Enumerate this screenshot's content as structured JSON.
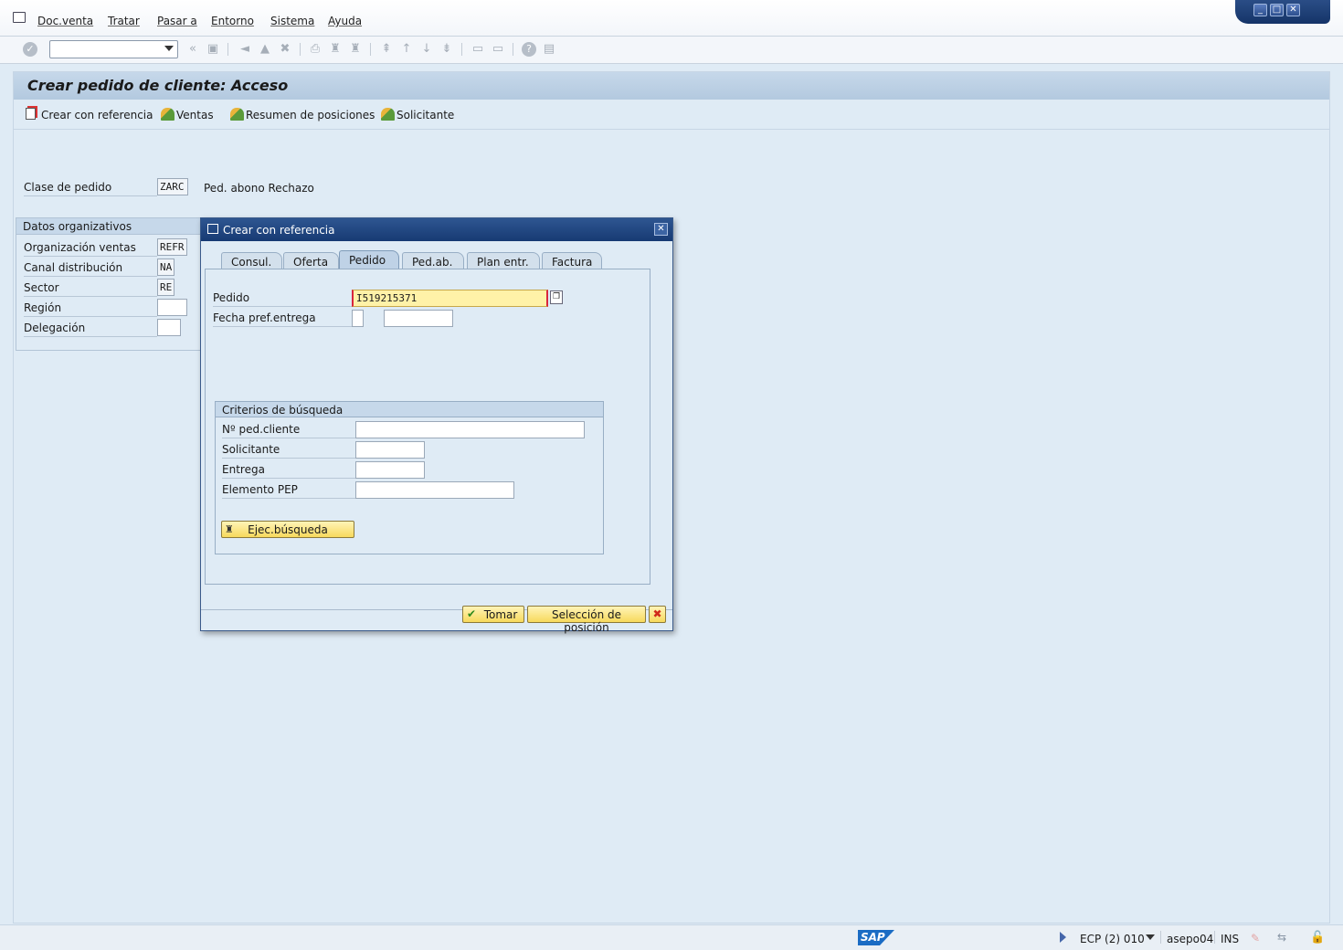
{
  "menu": {
    "items": [
      {
        "label": "Doc.venta"
      },
      {
        "label": "Tratar"
      },
      {
        "label": "Pasar a"
      },
      {
        "label": "Entorno"
      },
      {
        "label": "Sistema"
      },
      {
        "label": "Ayuda"
      }
    ]
  },
  "toolbar": {
    "command_value": ""
  },
  "screen": {
    "title": "Crear pedido de cliente: Acceso"
  },
  "app_toolbar": {
    "items": [
      {
        "label": "Crear con referencia",
        "icon": "document-icon"
      },
      {
        "label": "Ventas",
        "icon": "mountain-icon"
      },
      {
        "label": "Resumen de posiciones",
        "icon": "mountain-icon"
      },
      {
        "label": "Solicitante",
        "icon": "mountain-icon"
      }
    ]
  },
  "order_type": {
    "label": "Clase de pedido",
    "value": "ZARC",
    "description": "Ped. abono Rechazo"
  },
  "org_data": {
    "title": "Datos organizativos",
    "fields": [
      {
        "label": "Organización ventas",
        "value": "REFR"
      },
      {
        "label": "Canal distribución",
        "value": "NA"
      },
      {
        "label": "Sector",
        "value": "RE"
      },
      {
        "label": "Región",
        "value": ""
      },
      {
        "label": "Delegación",
        "value": ""
      }
    ]
  },
  "dialog": {
    "title": "Crear con referencia",
    "tabs": [
      {
        "label": "Consul."
      },
      {
        "label": "Oferta"
      },
      {
        "label": "Pedido"
      },
      {
        "label": "Ped.ab."
      },
      {
        "label": "Plan entr."
      },
      {
        "label": "Factura"
      }
    ],
    "active_tab": "Pedido",
    "pedido": {
      "label": "Pedido",
      "value": "I519215371"
    },
    "fecha": {
      "label": "Fecha pref.entrega",
      "value": ""
    },
    "criteria": {
      "title": "Criterios de búsqueda",
      "fields": [
        {
          "label": "Nº ped.cliente",
          "value": ""
        },
        {
          "label": "Solicitante",
          "value": ""
        },
        {
          "label": "Entrega",
          "value": ""
        },
        {
          "label": "Elemento PEP",
          "value": ""
        }
      ],
      "search_button": "Ejec.búsqueda"
    },
    "buttons": {
      "take": "Tomar",
      "select_pos": "Selección de posición"
    }
  },
  "status": {
    "system": "ECP (2) 010",
    "user": "asepo04",
    "mode": "INS",
    "logo": "SAP"
  },
  "colors": {
    "accent": "#173a73",
    "highlight": "#fff2a8"
  }
}
